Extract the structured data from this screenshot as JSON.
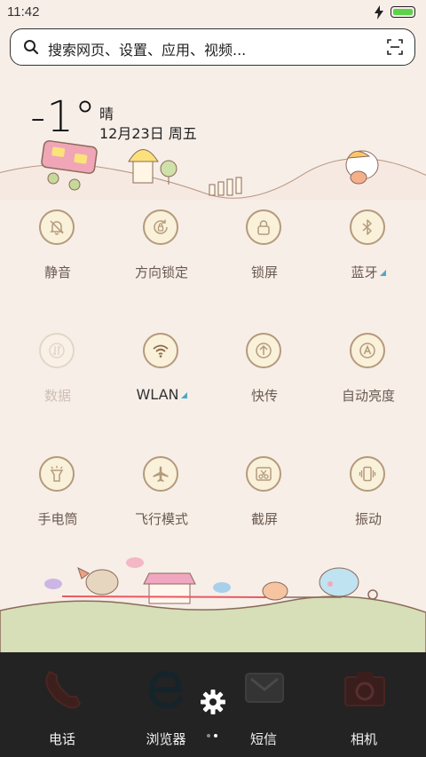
{
  "status": {
    "time": "11:42"
  },
  "search": {
    "placeholder": "搜索网页、设置、应用、视频..."
  },
  "weather": {
    "temperature": "-1°",
    "condition": "晴",
    "date": "12月23日 周五"
  },
  "toggles": [
    {
      "label": "静音",
      "icon": "bell-off-icon",
      "active": true
    },
    {
      "label": "方向锁定",
      "icon": "rotation-lock-icon",
      "active": true
    },
    {
      "label": "锁屏",
      "icon": "lock-icon",
      "active": true
    },
    {
      "label": "蓝牙",
      "icon": "bluetooth-icon",
      "active": true
    },
    {
      "label": "数据",
      "icon": "mobile-data-icon",
      "active": false
    },
    {
      "label": "WLAN",
      "icon": "wifi-icon",
      "active": true
    },
    {
      "label": "快传",
      "icon": "upload-icon",
      "active": true
    },
    {
      "label": "自动亮度",
      "icon": "auto-brightness-icon",
      "active": true
    },
    {
      "label": "手电筒",
      "icon": "flashlight-icon",
      "active": true
    },
    {
      "label": "飞行模式",
      "icon": "airplane-icon",
      "active": true
    },
    {
      "label": "截屏",
      "icon": "screenshot-icon",
      "active": true
    },
    {
      "label": "振动",
      "icon": "vibrate-icon",
      "active": true
    }
  ],
  "dock": [
    {
      "label": "电话",
      "icon": "phone-icon"
    },
    {
      "label": "浏览器",
      "icon": "browser-icon"
    },
    {
      "label": "短信",
      "icon": "message-icon"
    },
    {
      "label": "相机",
      "icon": "camera-icon"
    }
  ],
  "colors": {
    "background": "#f7eee8",
    "dock": "#232323",
    "battery": "#5cd34a",
    "icon_stroke": "#b49a7c",
    "accent_triangle": "#4aa9c8"
  }
}
